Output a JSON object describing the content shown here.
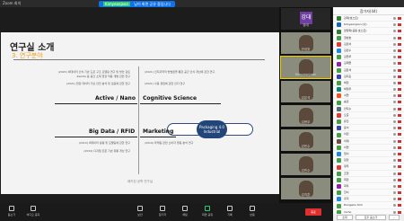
{
  "window": {
    "title": "Zoom 회의"
  },
  "banner": {
    "highlight": "Kimyeonjeon",
    "text": "님이 화면 공유 중입니다"
  },
  "slide": {
    "title": "연구실 소개",
    "subtitle": "3. 연구분야",
    "left_paras": [
      "(2020) 빅데이터 인식 기반 도로 구조 모델링 연구 및 방안 검토",
      "Zeolite 등 중간 소재 현장 적용 개발 관련 연구",
      "(2021) 현장 데이터 기반 안전 분석 및 검증에 관한 연구"
    ],
    "right_paras": [
      "(2021) 인지과학적 방법론을 통한 공간 인식 개선에 관한 연구",
      "(2021) 사용 경험에 관한 인지 연구"
    ],
    "sections": {
      "active_nano": "Active / Nano",
      "cognitive": "Cognitive Science",
      "bigdata": "Big Data / RFID",
      "marketing": "Marketing"
    },
    "bottom_left": [
      "(2019) 빅데이터 활용 및 모델링에 관한 연구",
      "(2019) 디지털 트윈 기반 유통 개선 연구"
    ],
    "bottom_right": [
      "(2019) 마케팅 관련 소비자 행동 분석 연구"
    ],
    "packaging": "Packaging 4.0 Industrial",
    "footer": "패키징 공학 연구실"
  },
  "tiles": [
    {
      "name": "강대",
      "type": "avatar",
      "initial": "강대"
    },
    {
      "name": "권성호",
      "type": "cam"
    },
    {
      "name": "Kimyeonjeon",
      "type": "cam",
      "active": true
    },
    {
      "name": "김은석",
      "type": "cam"
    },
    {
      "name": "김현우",
      "type": "cam"
    },
    {
      "name": "김민수",
      "type": "cam"
    },
    {
      "name": "김민수",
      "type": "cam"
    },
    {
      "name": "김지훈",
      "type": "cam"
    }
  ],
  "participants": {
    "header": "참가자(44)",
    "rows": [
      "강대(호스트)",
      "Kimyeonjeon (나)",
      "양정화(공동 호스트)",
      "권성호",
      "김민서",
      "김민수",
      "김현우",
      "김재현",
      "김은석",
      "김지훈",
      "박민",
      "박정우",
      "서현",
      "송민",
      "안지수",
      "오준",
      "유진",
      "윤서",
      "이민",
      "이재",
      "이현",
      "임서",
      "장민",
      "정우",
      "조현",
      "최민",
      "최우",
      "한서",
      "홍지",
      "Dongwoo Kim",
      "mcho"
    ],
    "av_colors": [
      "#2e7d32",
      "#1565c0",
      "#2e7d32",
      "#43a047",
      "#e53935",
      "#1e88e5",
      "#43a047",
      "#8e24aa",
      "#43a047",
      "#3949ab",
      "#43a047",
      "#00897b",
      "#f4511e",
      "#43a047",
      "#546e7a",
      "#e53935",
      "#43a047",
      "#3949ab",
      "#43a047",
      "#6d4c41",
      "#43a047",
      "#1e88e5",
      "#43a047",
      "#e53935",
      "#43a047",
      "#43a047",
      "#8e24aa",
      "#43a047",
      "#1e88e5",
      "#43a047",
      "#43a047"
    ],
    "invite": "초대",
    "mute_all": "모두 음소거",
    "more": "..."
  },
  "toolbar": {
    "mute": "음소거",
    "video": "비디오 중지",
    "security": "보안",
    "participants": "참가자",
    "chat": "채팅",
    "share": "화면 공유",
    "record": "기록",
    "reactions": "반응",
    "end": "종료"
  }
}
